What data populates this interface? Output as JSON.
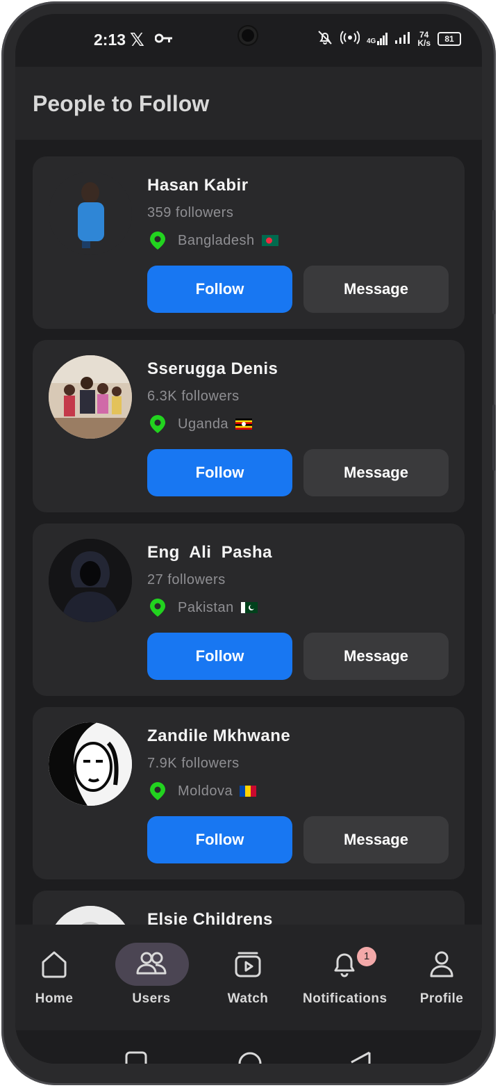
{
  "status_bar": {
    "time": "2:13",
    "x_label": "𝕏",
    "net_speed": "74",
    "net_unit": "K/s",
    "battery": "81",
    "lte": "4G"
  },
  "header": {
    "title": "People to Follow"
  },
  "people": [
    {
      "name": "Hasan Kabir",
      "followers": "359 followers",
      "country": "Bangladesh",
      "follow_label": "Follow",
      "message_label": "Message"
    },
    {
      "name": "Sserugga Denis",
      "followers": "6.3K followers",
      "country": "Uganda",
      "follow_label": "Follow",
      "message_label": "Message"
    },
    {
      "name": "Eng  Ali  Pasha",
      "followers": "27 followers",
      "country": "Pakistan",
      "follow_label": "Follow",
      "message_label": "Message"
    },
    {
      "name": "Zandile Mkhwane",
      "followers": "7.9K followers",
      "country": "Moldova",
      "follow_label": "Follow",
      "message_label": "Message"
    },
    {
      "name": "Elsie Childrens"
    }
  ],
  "nav": {
    "items": [
      {
        "label": "Home",
        "icon": "home-icon"
      },
      {
        "label": "Users",
        "icon": "users-icon",
        "active": true
      },
      {
        "label": "Watch",
        "icon": "watch-icon"
      },
      {
        "label": "Notifications",
        "icon": "bell-icon",
        "badge": "1"
      },
      {
        "label": "Profile",
        "icon": "profile-icon"
      }
    ]
  },
  "colors": {
    "accent": "#1877f2",
    "pin": "#22d31f",
    "background": "#1d1d1f",
    "card": "#29292b"
  }
}
